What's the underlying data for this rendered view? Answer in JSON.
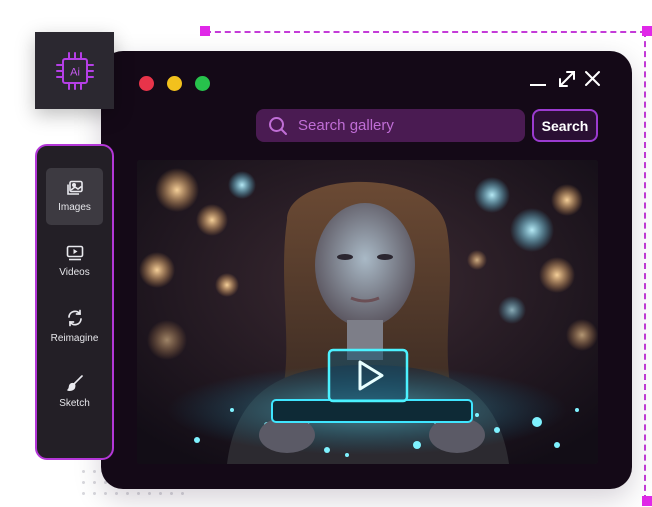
{
  "window": {
    "traffic_lights": [
      "#e8344a",
      "#f2c11d",
      "#27c24c"
    ],
    "controls": [
      "minimize-icon",
      "maximize-icon",
      "close-icon"
    ]
  },
  "search": {
    "placeholder": "Search gallery",
    "button_label": "Search"
  },
  "ai_badge": {
    "icon": "ai-chip-icon",
    "text": "Ai"
  },
  "sidebar": {
    "items": [
      {
        "label": "Images",
        "icon": "images-icon",
        "active": true
      },
      {
        "label": "Videos",
        "icon": "videos-icon",
        "active": false
      },
      {
        "label": "Reimagine",
        "icon": "reimagine-icon",
        "active": false
      },
      {
        "label": "Sketch",
        "icon": "sketch-icon",
        "active": false
      }
    ]
  },
  "hero": {
    "image": "woman-holding-tablet-with-glowing-play-button",
    "overlay_icon": "play-icon"
  },
  "colors": {
    "accent": "#b437d8",
    "window_bg": "#140917",
    "search_bg": "#4a1b52",
    "glow_cyan": "#3fe6ff"
  }
}
